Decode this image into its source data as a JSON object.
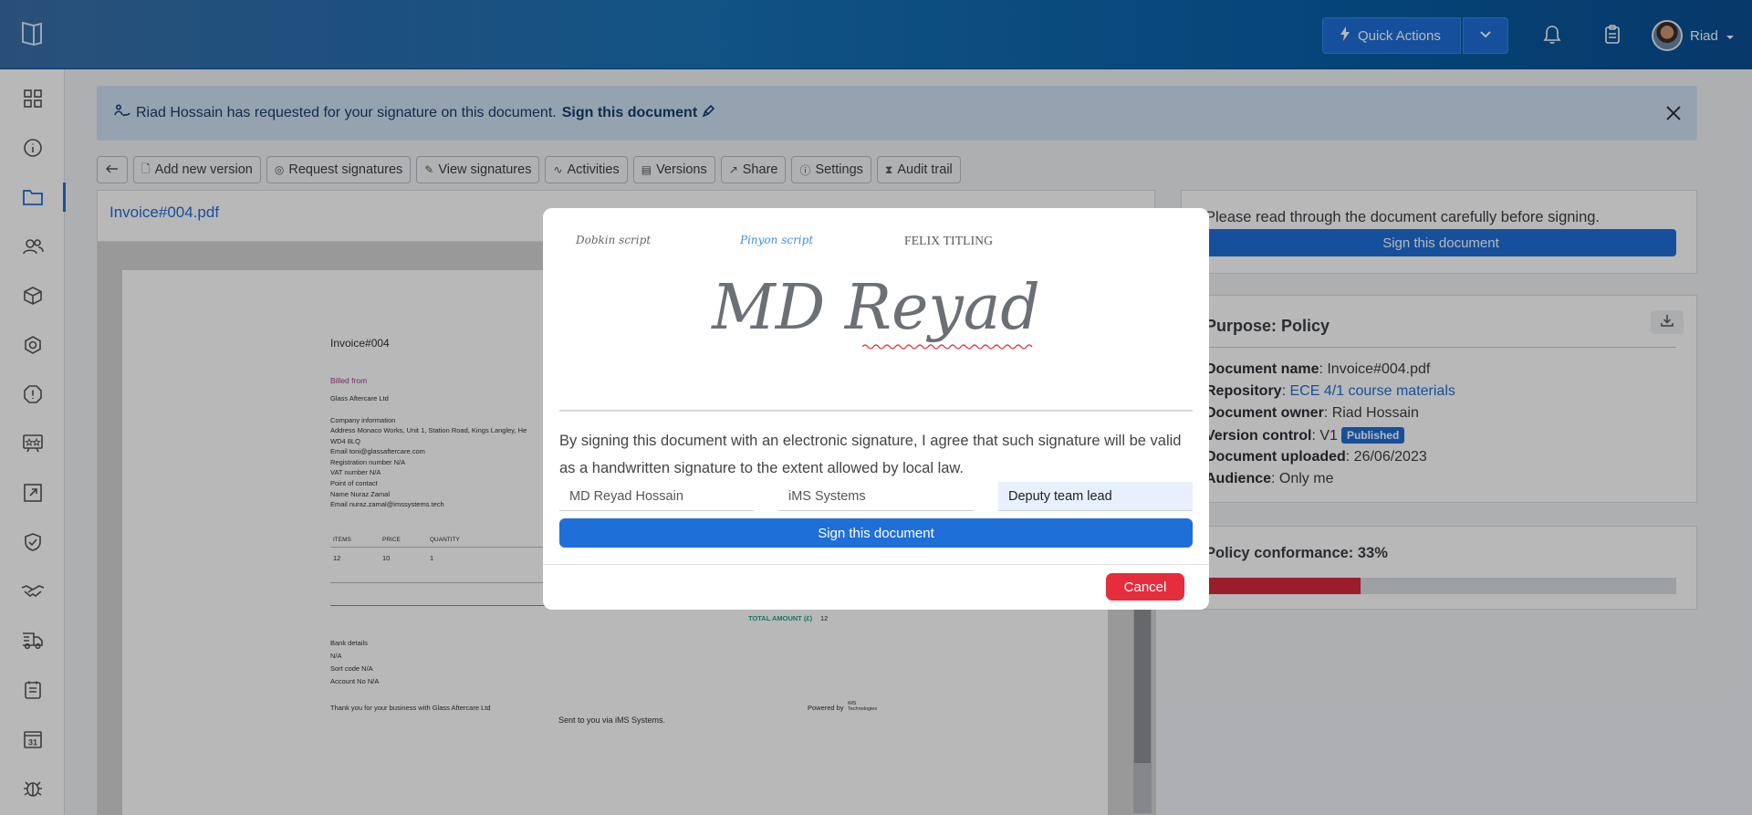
{
  "topbar": {
    "quick_actions_label": "Quick Actions",
    "user_name": "Riad",
    "colors": {
      "primary": "#1f6fd9",
      "danger": "#e52d3c"
    }
  },
  "sidebar": {
    "items": [
      "dashboard-icon",
      "info-icon",
      "folder-icon",
      "users-icon",
      "cube-icon",
      "hexagon-icon",
      "alert-icon",
      "rating-icon",
      "external-link-icon",
      "shield-icon",
      "handshake-icon",
      "truck-icon",
      "list-icon",
      "calendar-icon",
      "bug-icon"
    ],
    "calendar_day": "31"
  },
  "banner": {
    "message": "Riad Hossain has requested for your signature on this document.",
    "sign_link": "Sign this document"
  },
  "toolbar": {
    "add_version": "Add new version",
    "request_signatures": "Request signatures",
    "view_signatures": "View signatures",
    "activities": "Activities",
    "versions": "Versions",
    "share": "Share",
    "settings": "Settings",
    "audit_trail": "Audit trail"
  },
  "document": {
    "title": "Invoice#004.pdf",
    "invoice": {
      "title": "Invoice#004",
      "billed_from": "Billed from",
      "company": "Glass Aftercare Ltd",
      "company_info_label": "Company information",
      "address": "Address Monaco Works, Unit 1, Station Road, Kings Langley, He",
      "postcode": "WD4 8LQ",
      "email": "Email toni@glassaftercare.com",
      "registration": "Registration number N/A",
      "vat": "VAT number N/A",
      "contact_label": "Point of contact",
      "contact_name": "Name Nuraz Zamal",
      "contact_email": "Email nuraz.zamal@imssystems.tech",
      "columns": [
        "ITEMS",
        "PRICE",
        "QUANTITY"
      ],
      "row": [
        "12",
        "10",
        "1"
      ],
      "total_label": "TOTAL AMOUNT (£)",
      "total_value": "12",
      "bank_details": "Bank details",
      "bank_na": "N/A",
      "sort_code": "Sort code N/A",
      "account_no": "Account No N/A",
      "thanks": "Thank you for your business with Glass Aftercare Ltd",
      "powered_by": "Powered by",
      "powered_brand": "iMS Technologies",
      "sent_via": "Sent to you via iMS Systems."
    }
  },
  "right_panel": {
    "read_text": "Please read through the document carefully before signing.",
    "sign_button": "Sign this document",
    "purpose_title": "Purpose: Policy",
    "doc_name_label": "Document name",
    "doc_name": "Invoice#004.pdf",
    "repository_label": "Repository",
    "repository": "ECE 4/1 course materials",
    "owner_label": "Document owner",
    "owner": "Riad Hossain",
    "version_label": "Version control",
    "version": "V1",
    "version_badge": "Published",
    "uploaded_label": "Document uploaded",
    "uploaded": "26/06/2023",
    "audience_label": "Audience",
    "audience": "Only me",
    "conformance_label": "Policy conformance: 33%",
    "conformance_fraction": 0.33
  },
  "modal": {
    "font_options": [
      "Dobkin script",
      "Pinyon script",
      "FELIX TITLING"
    ],
    "signature_text": "MD Reyad",
    "agreement": "By signing this document with an electronic signature, I agree that such signature will be valid as a handwritten signature to the extent allowed by local law.",
    "name_value": "MD Reyad Hossain",
    "company_value": "iMS Systems",
    "role_value": "Deputy team lead",
    "sign_button": "Sign this document",
    "cancel_button": "Cancel"
  }
}
